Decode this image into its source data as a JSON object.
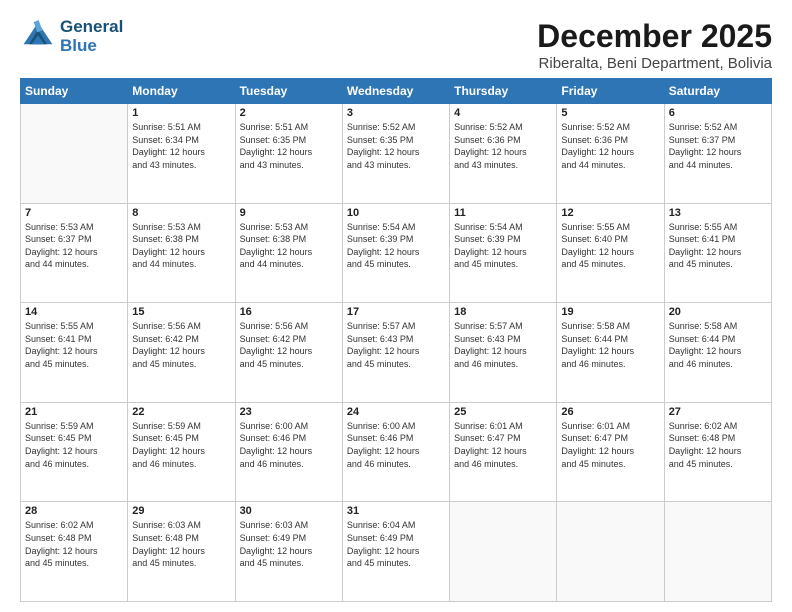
{
  "header": {
    "logo_line1": "General",
    "logo_line2": "Blue",
    "main_title": "December 2025",
    "subtitle": "Riberalta, Beni Department, Bolivia"
  },
  "days_of_week": [
    "Sunday",
    "Monday",
    "Tuesday",
    "Wednesday",
    "Thursday",
    "Friday",
    "Saturday"
  ],
  "weeks": [
    [
      {
        "day": "",
        "info": ""
      },
      {
        "day": "1",
        "info": "Sunrise: 5:51 AM\nSunset: 6:34 PM\nDaylight: 12 hours\nand 43 minutes."
      },
      {
        "day": "2",
        "info": "Sunrise: 5:51 AM\nSunset: 6:35 PM\nDaylight: 12 hours\nand 43 minutes."
      },
      {
        "day": "3",
        "info": "Sunrise: 5:52 AM\nSunset: 6:35 PM\nDaylight: 12 hours\nand 43 minutes."
      },
      {
        "day": "4",
        "info": "Sunrise: 5:52 AM\nSunset: 6:36 PM\nDaylight: 12 hours\nand 43 minutes."
      },
      {
        "day": "5",
        "info": "Sunrise: 5:52 AM\nSunset: 6:36 PM\nDaylight: 12 hours\nand 44 minutes."
      },
      {
        "day": "6",
        "info": "Sunrise: 5:52 AM\nSunset: 6:37 PM\nDaylight: 12 hours\nand 44 minutes."
      }
    ],
    [
      {
        "day": "7",
        "info": "Sunrise: 5:53 AM\nSunset: 6:37 PM\nDaylight: 12 hours\nand 44 minutes."
      },
      {
        "day": "8",
        "info": "Sunrise: 5:53 AM\nSunset: 6:38 PM\nDaylight: 12 hours\nand 44 minutes."
      },
      {
        "day": "9",
        "info": "Sunrise: 5:53 AM\nSunset: 6:38 PM\nDaylight: 12 hours\nand 44 minutes."
      },
      {
        "day": "10",
        "info": "Sunrise: 5:54 AM\nSunset: 6:39 PM\nDaylight: 12 hours\nand 45 minutes."
      },
      {
        "day": "11",
        "info": "Sunrise: 5:54 AM\nSunset: 6:39 PM\nDaylight: 12 hours\nand 45 minutes."
      },
      {
        "day": "12",
        "info": "Sunrise: 5:55 AM\nSunset: 6:40 PM\nDaylight: 12 hours\nand 45 minutes."
      },
      {
        "day": "13",
        "info": "Sunrise: 5:55 AM\nSunset: 6:41 PM\nDaylight: 12 hours\nand 45 minutes."
      }
    ],
    [
      {
        "day": "14",
        "info": "Sunrise: 5:55 AM\nSunset: 6:41 PM\nDaylight: 12 hours\nand 45 minutes."
      },
      {
        "day": "15",
        "info": "Sunrise: 5:56 AM\nSunset: 6:42 PM\nDaylight: 12 hours\nand 45 minutes."
      },
      {
        "day": "16",
        "info": "Sunrise: 5:56 AM\nSunset: 6:42 PM\nDaylight: 12 hours\nand 45 minutes."
      },
      {
        "day": "17",
        "info": "Sunrise: 5:57 AM\nSunset: 6:43 PM\nDaylight: 12 hours\nand 45 minutes."
      },
      {
        "day": "18",
        "info": "Sunrise: 5:57 AM\nSunset: 6:43 PM\nDaylight: 12 hours\nand 46 minutes."
      },
      {
        "day": "19",
        "info": "Sunrise: 5:58 AM\nSunset: 6:44 PM\nDaylight: 12 hours\nand 46 minutes."
      },
      {
        "day": "20",
        "info": "Sunrise: 5:58 AM\nSunset: 6:44 PM\nDaylight: 12 hours\nand 46 minutes."
      }
    ],
    [
      {
        "day": "21",
        "info": "Sunrise: 5:59 AM\nSunset: 6:45 PM\nDaylight: 12 hours\nand 46 minutes."
      },
      {
        "day": "22",
        "info": "Sunrise: 5:59 AM\nSunset: 6:45 PM\nDaylight: 12 hours\nand 46 minutes."
      },
      {
        "day": "23",
        "info": "Sunrise: 6:00 AM\nSunset: 6:46 PM\nDaylight: 12 hours\nand 46 minutes."
      },
      {
        "day": "24",
        "info": "Sunrise: 6:00 AM\nSunset: 6:46 PM\nDaylight: 12 hours\nand 46 minutes."
      },
      {
        "day": "25",
        "info": "Sunrise: 6:01 AM\nSunset: 6:47 PM\nDaylight: 12 hours\nand 46 minutes."
      },
      {
        "day": "26",
        "info": "Sunrise: 6:01 AM\nSunset: 6:47 PM\nDaylight: 12 hours\nand 45 minutes."
      },
      {
        "day": "27",
        "info": "Sunrise: 6:02 AM\nSunset: 6:48 PM\nDaylight: 12 hours\nand 45 minutes."
      }
    ],
    [
      {
        "day": "28",
        "info": "Sunrise: 6:02 AM\nSunset: 6:48 PM\nDaylight: 12 hours\nand 45 minutes."
      },
      {
        "day": "29",
        "info": "Sunrise: 6:03 AM\nSunset: 6:48 PM\nDaylight: 12 hours\nand 45 minutes."
      },
      {
        "day": "30",
        "info": "Sunrise: 6:03 AM\nSunset: 6:49 PM\nDaylight: 12 hours\nand 45 minutes."
      },
      {
        "day": "31",
        "info": "Sunrise: 6:04 AM\nSunset: 6:49 PM\nDaylight: 12 hours\nand 45 minutes."
      },
      {
        "day": "",
        "info": ""
      },
      {
        "day": "",
        "info": ""
      },
      {
        "day": "",
        "info": ""
      }
    ]
  ]
}
